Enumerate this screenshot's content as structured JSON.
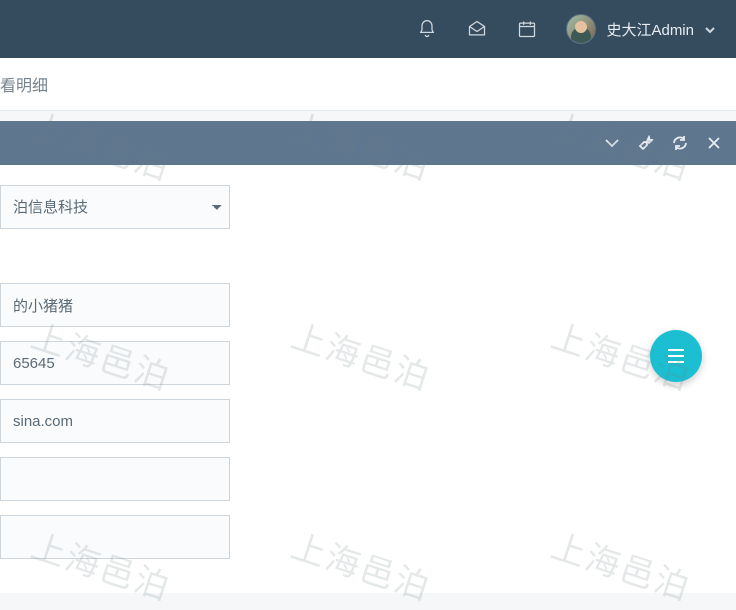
{
  "watermark": "上海邑泊",
  "topbar": {
    "user_name": "史大江Admin"
  },
  "breadcrumb": {
    "tail": "看明细"
  },
  "form": {
    "company_select": "泊信息科技",
    "field2": "的小猪猪",
    "field3": "65645",
    "field4": "sina.com",
    "field5": "",
    "field6": ""
  }
}
